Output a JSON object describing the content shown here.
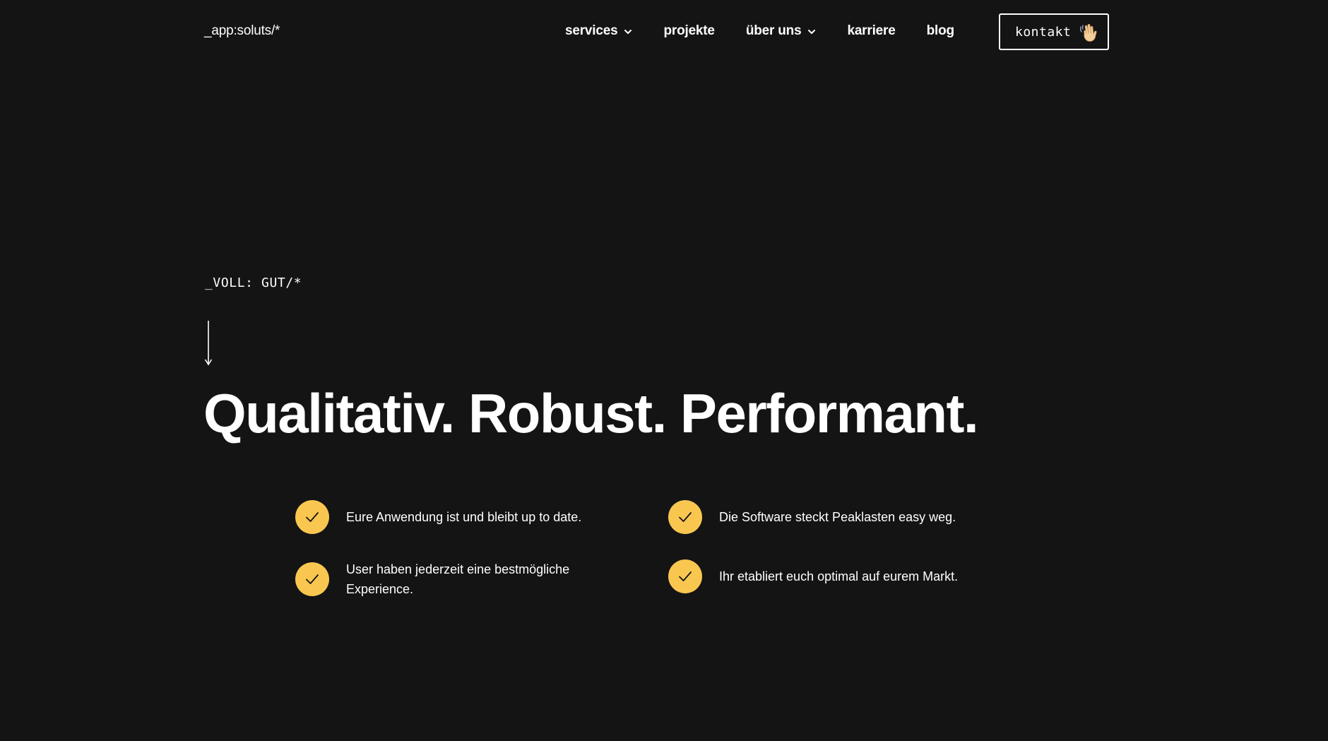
{
  "header": {
    "logo": "_app:soluts/*",
    "nav": [
      {
        "label": "services",
        "has_dropdown": true
      },
      {
        "label": "projekte",
        "has_dropdown": false
      },
      {
        "label": "über uns",
        "has_dropdown": true
      },
      {
        "label": "karriere",
        "has_dropdown": false
      },
      {
        "label": "blog",
        "has_dropdown": false
      }
    ],
    "cta_label": "kontakt",
    "cta_icon": "waving-hand-icon"
  },
  "hero": {
    "eyebrow": "_VOLL: GUT/*",
    "headline": "Qualitativ. Robust. Performant."
  },
  "features": [
    {
      "text": "Eure Anwendung ist und bleibt up to date.",
      "icon": "check-icon"
    },
    {
      "text": "Die Software steckt Peaklasten easy weg.",
      "icon": "check-icon"
    },
    {
      "text": "User haben jederzeit eine bestmögliche Experience.",
      "icon": "check-icon"
    },
    {
      "text": "Ihr etabliert euch optimal auf eurem Markt.",
      "icon": "check-icon"
    }
  ],
  "colors": {
    "background": "#141414",
    "text": "#ffffff",
    "accent": "#f9c74f"
  }
}
